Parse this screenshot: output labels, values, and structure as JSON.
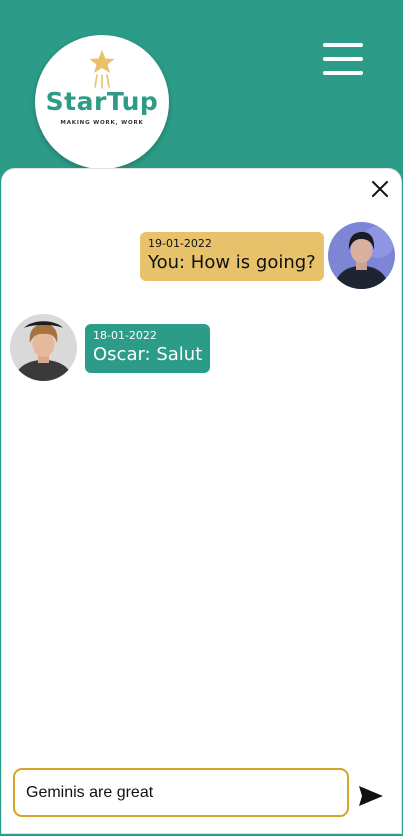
{
  "header": {
    "logo": {
      "name": "StarTup",
      "tagline": "MAKING WORK, WORK"
    }
  },
  "chat": {
    "messages": [
      {
        "date": "19-01-2022",
        "text": "You: How is going?",
        "sender": "self"
      },
      {
        "date": "18-01-2022",
        "text": "Oscar: Salut",
        "sender": "Oscar"
      }
    ]
  },
  "composer": {
    "value": "Geminis are great"
  },
  "icons": {
    "menu": "hamburger-menu-icon",
    "close": "close-icon",
    "send": "send-icon",
    "logo_star": "star-icon"
  },
  "colors": {
    "brand_teal": "#2c9c88",
    "my_bubble": "#e8c26a",
    "their_bubble": "#2c9c88",
    "input_border": "#d8a32c"
  }
}
